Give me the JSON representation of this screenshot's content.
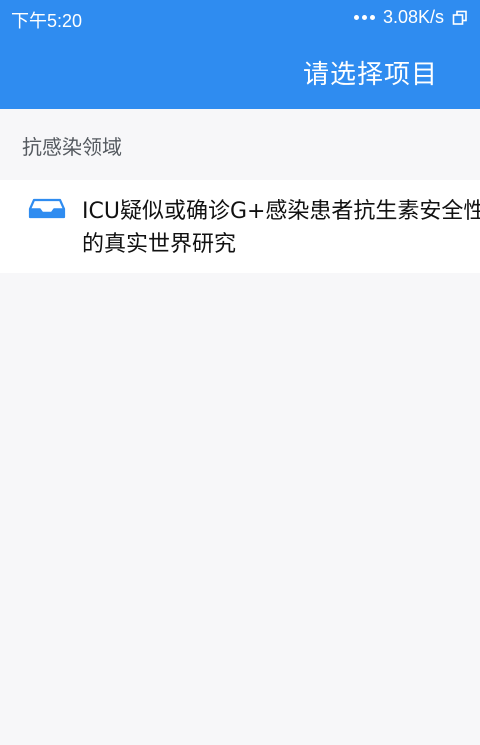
{
  "status_bar": {
    "time": "下午5:20",
    "network_speed": "3.08K/s"
  },
  "header": {
    "title": "请选择项目"
  },
  "section": {
    "label": "抗感染领域"
  },
  "projects": [
    {
      "icon": "inbox-tray-icon",
      "title": "ICU疑似或确诊G+感染患者抗生素安全性的真实世界研究"
    }
  ],
  "colors": {
    "accent": "#2f8cf0",
    "background": "#f7f7f9",
    "card": "#ffffff"
  }
}
